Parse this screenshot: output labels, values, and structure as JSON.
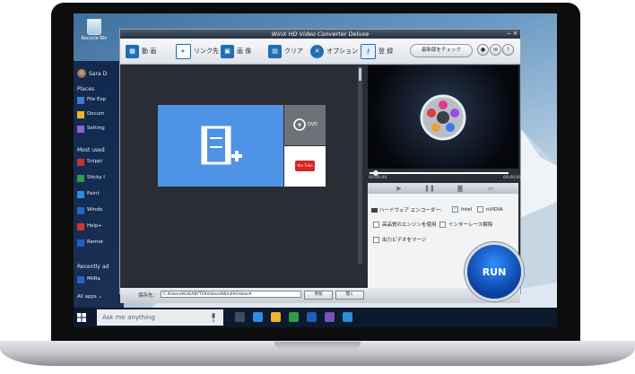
{
  "desktop": {
    "recycle_label": "Recycle Bin"
  },
  "start_menu": {
    "user_name": "Sara D",
    "places_header": "Places",
    "places": [
      {
        "label": "File Exp",
        "color": "#3a7bd5"
      },
      {
        "label": "Docum",
        "color": "#f0b429"
      },
      {
        "label": "Setting",
        "color": "#8f63c7"
      }
    ],
    "most_used_header": "Most used",
    "most_used": [
      {
        "label": "Snippi",
        "color": "#c4342d"
      },
      {
        "label": "Sticky I",
        "color": "#2f9e44"
      },
      {
        "label": "Paint",
        "color": "#2b8fd8"
      },
      {
        "label": "Windo",
        "color": "#2f62c2"
      },
      {
        "label": "Help+",
        "color": "#d9342b"
      },
      {
        "label": "Remot",
        "color": "#1f5fbf"
      }
    ],
    "recent_header": "Recently ad",
    "recent": [
      {
        "label": "MiiRa",
        "color": "#2f62c2"
      }
    ],
    "all_apps": "All apps",
    "all_apps_arrow": "⌄"
  },
  "taskbar": {
    "search_placeholder": "Ask me anything",
    "mic_icon": "microphone-icon",
    "apps": [
      {
        "name": "task-view-icon",
        "color": "#3d4d63"
      },
      {
        "name": "edge-icon",
        "color": "#2a8fe0"
      },
      {
        "name": "explorer-icon",
        "color": "#f0b429"
      },
      {
        "name": "store-icon",
        "color": "#2f9e44"
      },
      {
        "name": "photos-icon",
        "color": "#1f5fbf"
      },
      {
        "name": "trophy-icon",
        "color": "#7b4fc2"
      },
      {
        "name": "app-icon",
        "color": "#2b8fd8"
      }
    ]
  },
  "app": {
    "title": "WinX HD Video Converter Deluxe",
    "toolbar": {
      "video": "動 画",
      "link": "リンク先",
      "photo": "画 像",
      "clear": "クリア",
      "options": "オプション",
      "register": "登 録",
      "update_check": "最新版をチェック",
      "youtube_glyph": "You Tube"
    },
    "tiles": {
      "dvd_label": "DVD",
      "youtube_label": "You Tube"
    },
    "save": {
      "label": "保存先:",
      "path": "C:¥Users¥GIGABYTE¥Videos¥WinX¥Videos¥",
      "browse": "参照",
      "open": "開く"
    },
    "player": {
      "time_current": "00:00:00",
      "time_total": "00:00:00"
    },
    "options": {
      "hw_encoder": "ハードウェア エンコーダー:",
      "intel": "Intel",
      "nvidia": "nVIDIA",
      "high_quality": "高品質のエンジンを使用",
      "deinterlace": "インターレース解除",
      "merge": "出力ビデオをマージ",
      "intel_checked": true
    },
    "run_label": "RUN"
  }
}
